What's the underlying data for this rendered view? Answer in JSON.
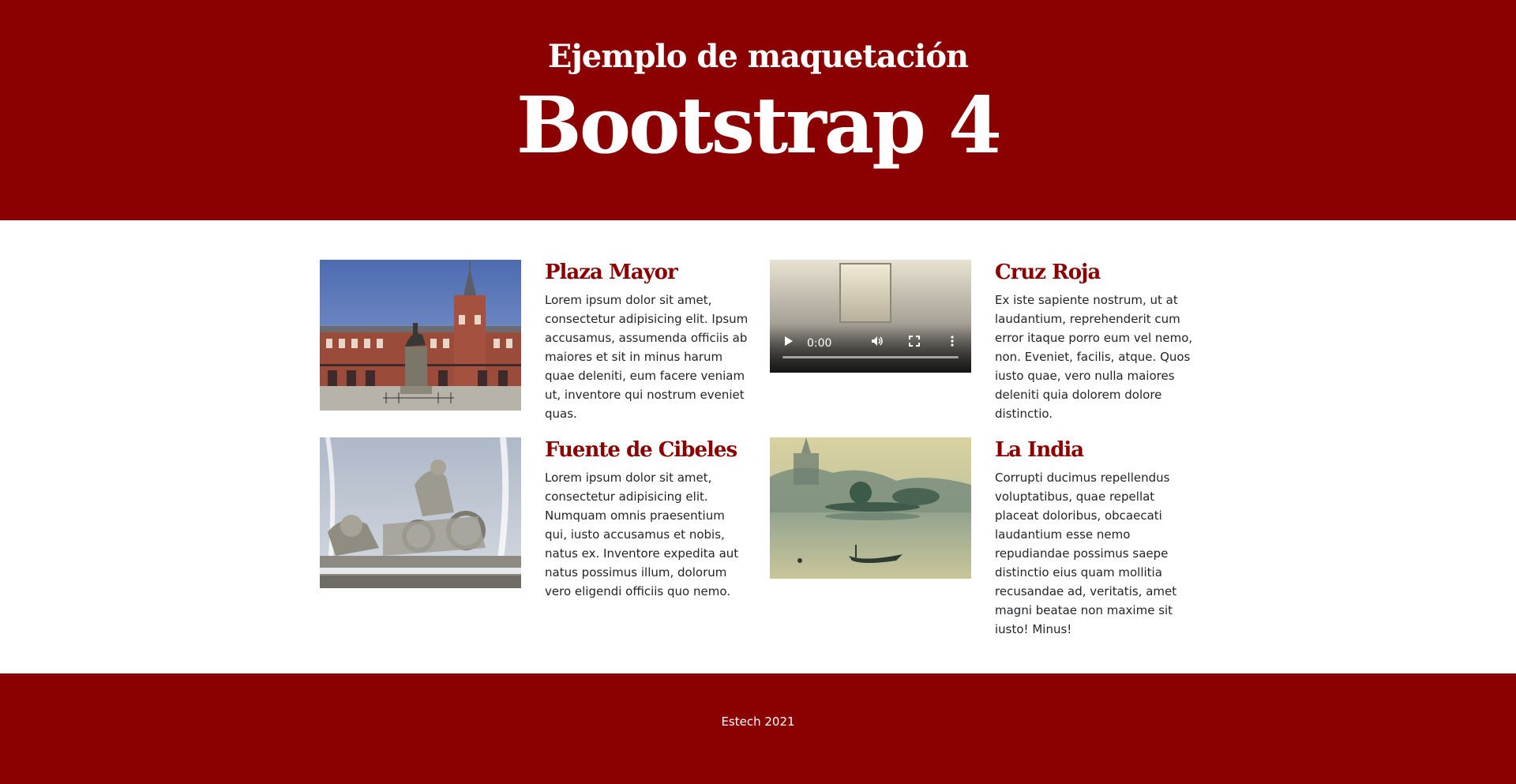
{
  "header": {
    "subtitle": "Ejemplo de maquetación",
    "title": "Bootstrap 4"
  },
  "cards": [
    {
      "title": "Plaza Mayor",
      "text": "Lorem ipsum dolor sit amet, consectetur adipisicing elit. Ipsum accusamus, assumenda officiis ab maiores et sit in minus harum quae deleniti, eum facere veniam ut, inventore qui nostrum eveniet quas.",
      "media": "image"
    },
    {
      "title": "Cruz Roja",
      "text": "Ex iste sapiente nostrum, ut at laudantium, reprehenderit cum error itaque porro eum vel nemo, non. Eveniet, facilis, atque. Quos iusto quae, vero nulla maiores deleniti quia dolorem dolore distinctio.",
      "media": "video",
      "video_time": "0:00"
    },
    {
      "title": "Fuente de Cibeles",
      "text": "Lorem ipsum dolor sit amet, consectetur adipisicing elit. Numquam omnis praesentium qui, iusto accusamus et nobis, natus ex. Inventore expedita aut natus possimus illum, dolorum vero eligendi officiis quo nemo.",
      "media": "image"
    },
    {
      "title": "La India",
      "text": "Corrupti ducimus repellendus voluptatibus, quae repellat placeat doloribus, obcaecati laudantium esse nemo repudiandae possimus saepe distinctio eius quam mollitia recusandae ad, veritatis, amet magni beatae non maxime sit iusto! Minus!",
      "media": "image"
    }
  ],
  "footer": {
    "text": "Estech 2021"
  },
  "colors": {
    "brand": "#8b0000",
    "body_text": "#212529",
    "background": "#ffffff"
  },
  "icons": [
    "play-icon",
    "volume-icon",
    "fullscreen-icon",
    "more-options-icon"
  ]
}
